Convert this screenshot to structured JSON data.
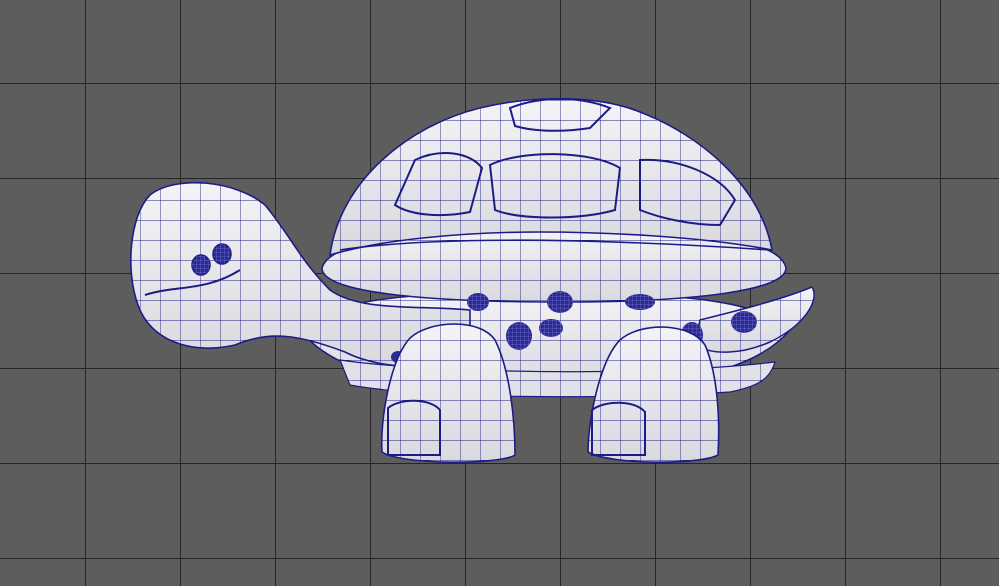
{
  "viewport": {
    "background_color": "#5d5d5d",
    "grid_color": "#262626",
    "grid": true
  },
  "model": {
    "name": "turtle",
    "display_mode": "wireframe-on-shaded",
    "shaded_color": "#ececef",
    "wire_color": "#1d1c86",
    "spot_color": "#2a2a9a",
    "parts": [
      "shell-dome",
      "shell-rim",
      "body",
      "head",
      "eyes",
      "tail",
      "front-leg",
      "back-leg",
      "spots"
    ]
  }
}
